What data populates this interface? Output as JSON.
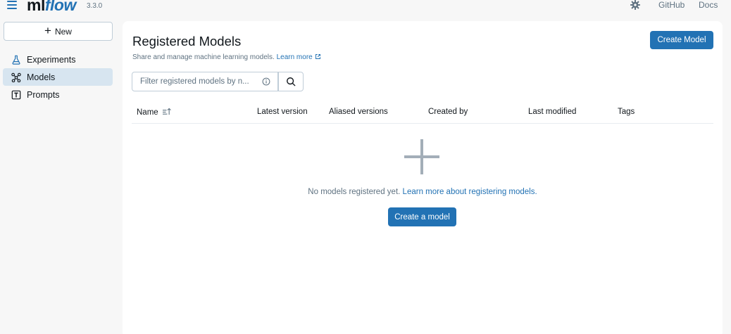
{
  "app": {
    "logo_ml": "ml",
    "logo_flow": "flow",
    "version": "3.3.0",
    "links": [
      "GitHub",
      "Docs"
    ]
  },
  "sidebar": {
    "new_label": "New",
    "items": [
      {
        "label": "Experiments",
        "icon": "beaker-icon",
        "active": false
      },
      {
        "label": "Models",
        "icon": "models-icon",
        "active": true
      },
      {
        "label": "Prompts",
        "icon": "prompt-icon",
        "active": false
      }
    ]
  },
  "main": {
    "title": "Registered Models",
    "subtitle": "Share and manage machine learning models.",
    "learn_more": "Learn more",
    "create_model_label": "Create Model",
    "search_placeholder": "Filter registered models by n...",
    "columns": [
      "Name",
      "Latest version",
      "Aliased versions",
      "Created by",
      "Last modified",
      "Tags"
    ],
    "empty_text": "No models registered yet.",
    "empty_link": "Learn more about registering models.",
    "create_a_model_label": "Create a model"
  },
  "colors": {
    "accent": "#2272b4",
    "sidebar_active": "#d7e5f0",
    "background": "#f7f7f7"
  }
}
